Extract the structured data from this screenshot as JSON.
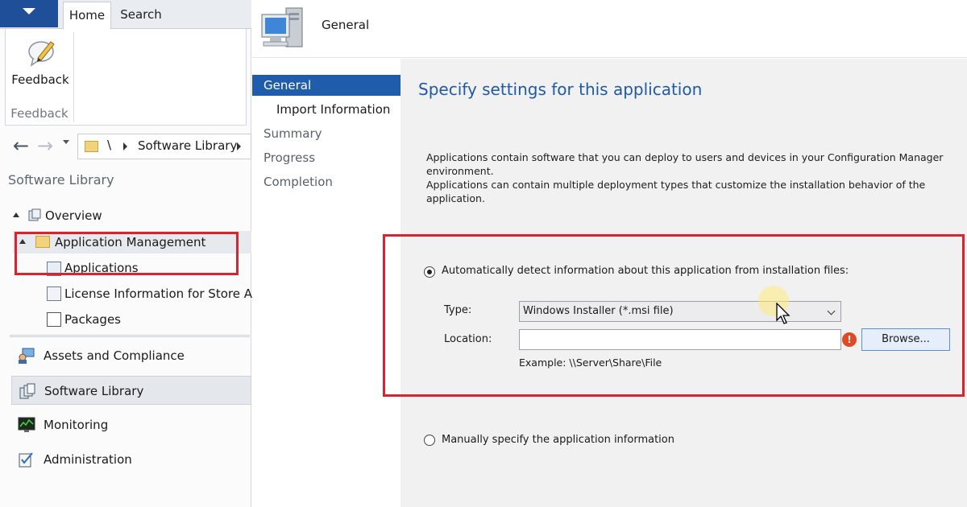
{
  "ribbon": {
    "tabs": [
      "Home",
      "Search"
    ],
    "feedback_button": "Feedback",
    "group_label": "Feedback"
  },
  "address_bar": {
    "root": "\\",
    "crumb": "Software Library"
  },
  "workspace": {
    "title": "Software Library",
    "tree": {
      "overview": "Overview",
      "application_management": "Application Management",
      "applications": "Applications",
      "license_info": "License Information for Store Apps",
      "packages": "Packages"
    },
    "wunderbar": {
      "assets": "Assets and Compliance",
      "software_library": "Software Library",
      "monitoring": "Monitoring",
      "administration": "Administration"
    }
  },
  "wizard": {
    "header_title": "General",
    "steps": {
      "general": "General",
      "import": "Import Information",
      "summary": "Summary",
      "progress": "Progress",
      "completion": "Completion"
    },
    "main_title": "Specify settings for this application",
    "intro_line1": "Applications contain software that you can deploy to users and devices in your Configuration Manager environment.",
    "intro_line2": "Applications can contain multiple deployment types that customize the installation behavior of the application.",
    "option_auto": "Automatically detect information about this application from installation files:",
    "type_label": "Type:",
    "type_value": "Windows Installer (*.msi file)",
    "location_label": "Location:",
    "location_value": "",
    "browse_label": "Browse...",
    "example_text": "Example: \\\\Server\\Share\\File",
    "option_manual": "Manually specify the application information",
    "auto_selected": true
  },
  "colors": {
    "accent": "#1f5cab",
    "title_blue": "#1e5aa8",
    "highlight_red": "#d9232e"
  }
}
